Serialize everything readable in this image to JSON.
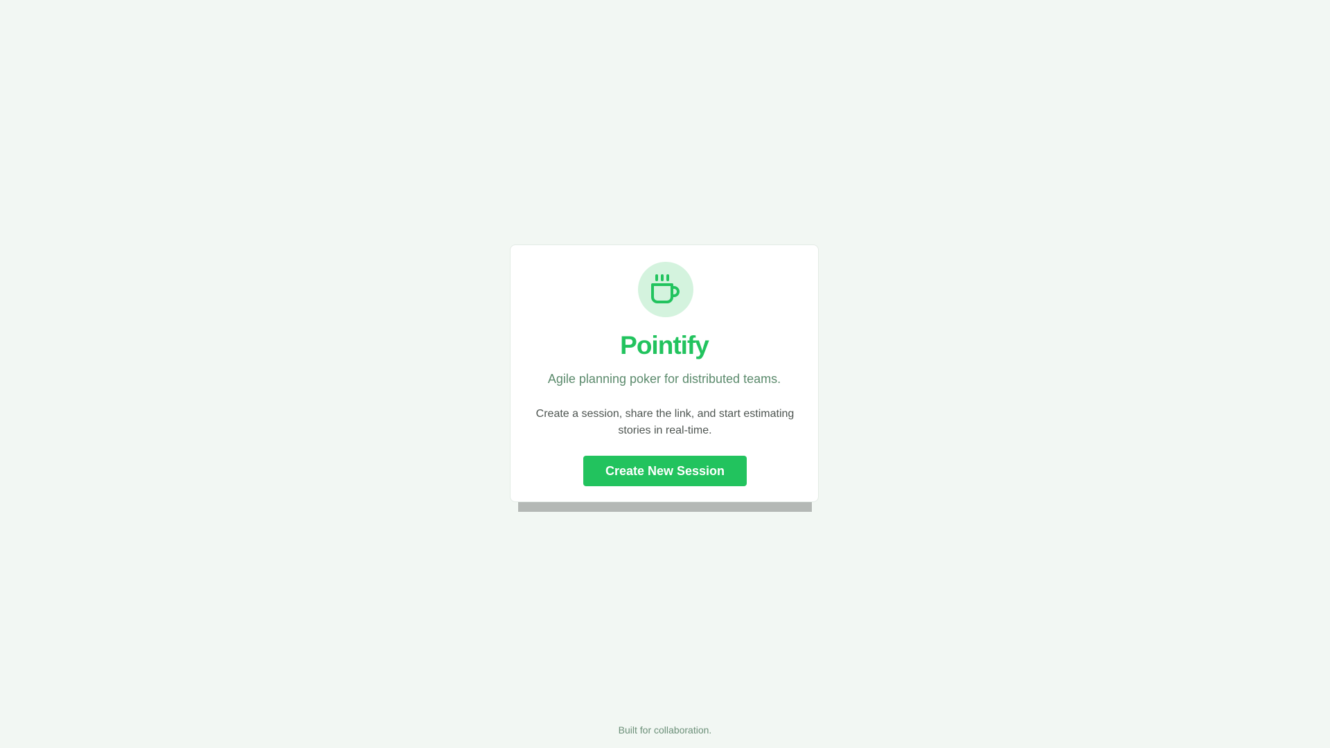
{
  "app": {
    "name": "Pointify",
    "tagline": "Agile planning poker for distributed teams.",
    "description": "Create a session, share the link, and start estimating stories in real-time.",
    "icon": "coffee-mug-icon"
  },
  "actions": {
    "create_session_label": "Create New Session"
  },
  "footer": {
    "text": "Built for collaboration."
  },
  "colors": {
    "background": "#f2f7f3",
    "accent": "#22c35e",
    "icon_bg": "#d4f3de",
    "subtitle": "#5b8a6c",
    "body_text": "#4e5551"
  }
}
